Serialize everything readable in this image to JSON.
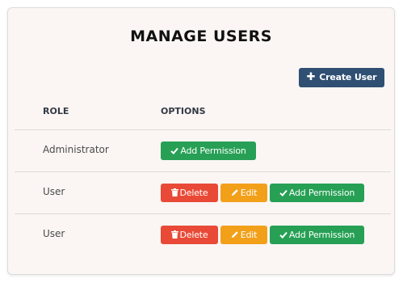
{
  "page": {
    "title": "MANAGE USERS"
  },
  "toolbar": {
    "create_label": "Create User",
    "create_icon": "plus-icon"
  },
  "table": {
    "headers": [
      "ROLE",
      "OPTIONS"
    ],
    "rows": [
      {
        "role": "Administrator",
        "actions": [
          {
            "label": "Add Permission",
            "icon": "check-icon"
          }
        ]
      },
      {
        "role": "User",
        "actions": [
          {
            "label": "Delete",
            "icon": "trash-icon"
          },
          {
            "label": "Edit",
            "icon": "pencil-icon"
          },
          {
            "label": "Add Permission",
            "icon": "check-icon"
          }
        ]
      },
      {
        "role": "User",
        "actions": [
          {
            "label": "Delete",
            "icon": "trash-icon"
          },
          {
            "label": "Edit",
            "icon": "pencil-icon"
          },
          {
            "label": "Add Permission",
            "icon": "check-icon"
          }
        ]
      }
    ]
  },
  "colors": {
    "create": "#2f4f73",
    "add": "#27a055",
    "delete": "#e84a37",
    "edit": "#f2a01a",
    "card_bg": "#fbf6f4"
  }
}
